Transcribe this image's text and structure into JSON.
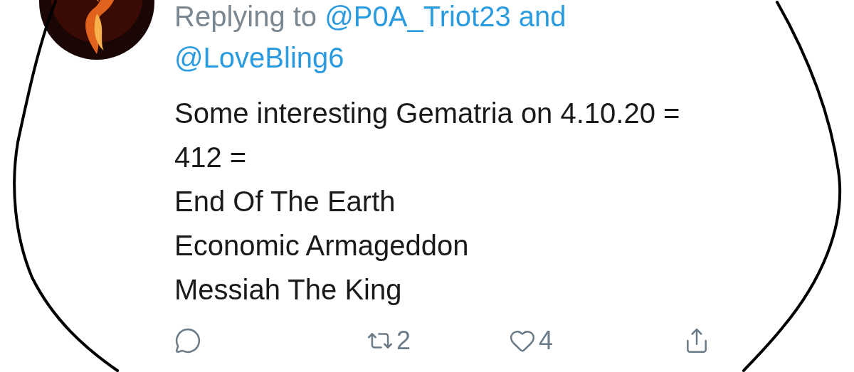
{
  "tweet": {
    "reply_context": {
      "prefix": "Replying to",
      "mentions": [
        "@P0A_Triot23",
        "@LoveBling6"
      ],
      "joiner": "and"
    },
    "text_lines": [
      "Some interesting Gematria on 4.10.20 =",
      "412 =",
      "End Of The Earth",
      "Economic Armageddon",
      "Messiah The King"
    ],
    "actions": [
      {
        "kind": "reply"
      },
      {
        "kind": "retweet",
        "count": "2"
      },
      {
        "kind": "like",
        "count": "4"
      },
      {
        "kind": "share"
      }
    ]
  }
}
